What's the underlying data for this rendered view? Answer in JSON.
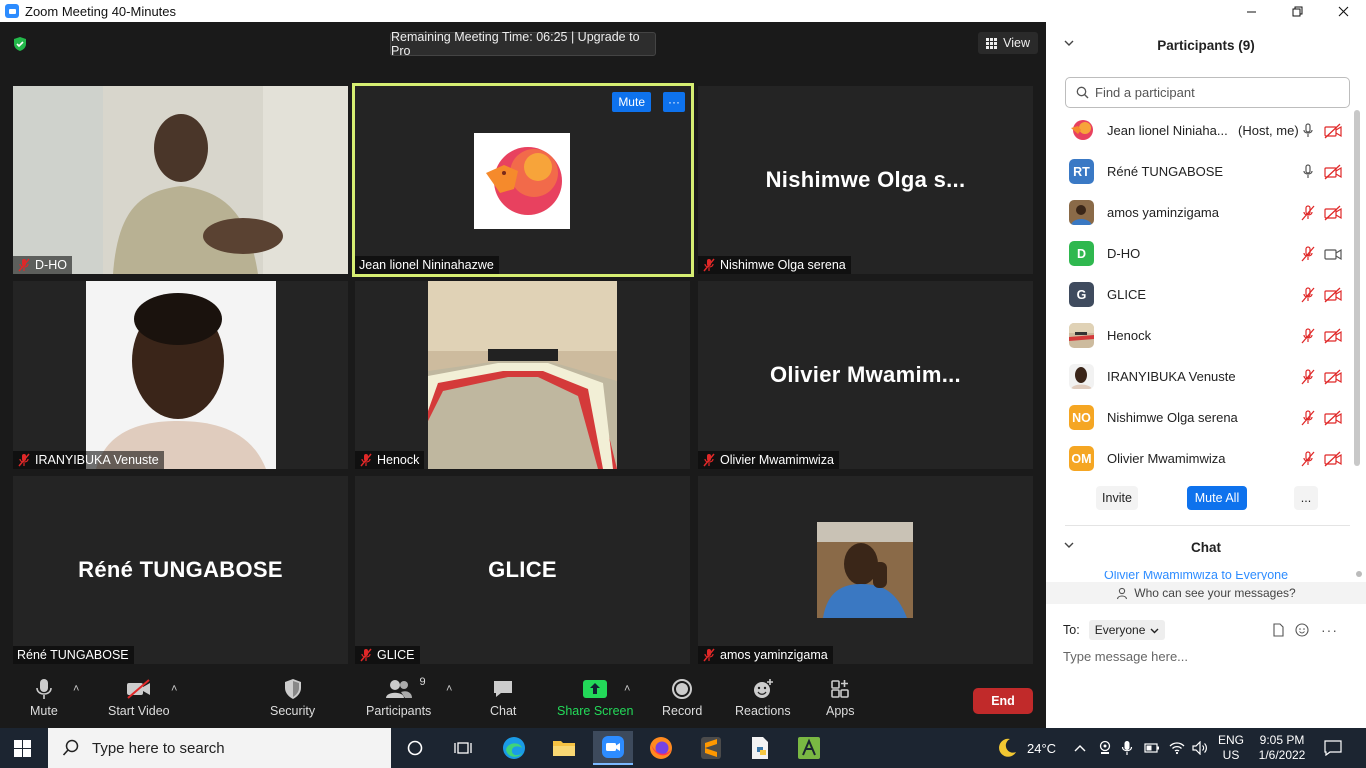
{
  "window": {
    "title": "Zoom Meeting 40-Minutes",
    "controls": [
      "minimize",
      "restore",
      "close"
    ]
  },
  "meeting": {
    "remaining_time": "Remaining Meeting Time: 06:25 | Upgrade to Pro",
    "view_label": "View",
    "tiles": [
      {
        "name": "D-HO",
        "kind": "video",
        "muted": true
      },
      {
        "name": "Jean lionel Nininahazwe",
        "kind": "avatar-image",
        "active": true,
        "mute_label": "Mute",
        "more_label": "···"
      },
      {
        "name": "Nishimwe Olga serena",
        "display": "Nishimwe Olga s...",
        "kind": "text",
        "muted": true
      },
      {
        "name": "IRANYIBUKA Venuste",
        "kind": "photo",
        "muted": true
      },
      {
        "name": "Henock",
        "kind": "photo",
        "muted": true
      },
      {
        "name": "Olivier Mwamimwiza",
        "display": "Olivier  Mwamim...",
        "kind": "text",
        "muted": true
      },
      {
        "name": "Réné TUNGABOSE",
        "display": "Réné TUNGABOSE",
        "kind": "text",
        "muted": false
      },
      {
        "name": "GLICE",
        "display": "GLICE",
        "kind": "text",
        "muted": true
      },
      {
        "name": "amos yaminzigama",
        "kind": "photo",
        "muted": true
      }
    ]
  },
  "toolbar": {
    "mute": "Mute",
    "start_video": "Start Video",
    "security": "Security",
    "participants": "Participants",
    "participants_count": "9",
    "chat": "Chat",
    "share_screen": "Share Screen",
    "record": "Record",
    "reactions": "Reactions",
    "apps": "Apps",
    "end": "End"
  },
  "panel": {
    "participants_title": "Participants (9)",
    "find_placeholder": "Find a participant",
    "participants": [
      {
        "name": "Jean lionel Niniaha...",
        "host_label": "(Host, me)",
        "avatar_type": "image",
        "mic": "on",
        "cam": "off"
      },
      {
        "name": "Réné TUNGABOSE",
        "initials": "RT",
        "color": "#3a79c5",
        "mic": "on",
        "cam": "off"
      },
      {
        "name": "amos yaminzigama",
        "avatar_type": "image",
        "mic": "off",
        "cam": "off"
      },
      {
        "name": "D-HO",
        "initials": "D",
        "color": "#2fb84f",
        "mic": "off",
        "cam": "on"
      },
      {
        "name": "GLICE",
        "initials": "G",
        "color": "#3f4b5e",
        "mic": "off",
        "cam": "off"
      },
      {
        "name": "Henock",
        "avatar_type": "image",
        "mic": "off",
        "cam": "off"
      },
      {
        "name": "IRANYIBUKA Venuste",
        "avatar_type": "image",
        "mic": "off",
        "cam": "off"
      },
      {
        "name": "Nishimwe Olga serena",
        "initials": "NO",
        "color": "#f5a623",
        "mic": "off",
        "cam": "off"
      },
      {
        "name": "Olivier Mwamimwiza",
        "initials": "OM",
        "color": "#f5a623",
        "mic": "off",
        "cam": "off"
      }
    ],
    "invite": "Invite",
    "mute_all": "Mute All",
    "more": "...",
    "chat_title": "Chat",
    "chat_peek": "Olivier Mwamimwiza to Everyone",
    "who_can_see": "Who can see your messages?",
    "to_label": "To:",
    "to_value": "Everyone",
    "message_placeholder": "Type message here..."
  },
  "taskbar": {
    "search_placeholder": "Type here to search",
    "temperature": "24°C",
    "lang_top": "ENG",
    "lang_bottom": "US",
    "time": "9:05 PM",
    "date": "1/6/2022"
  }
}
